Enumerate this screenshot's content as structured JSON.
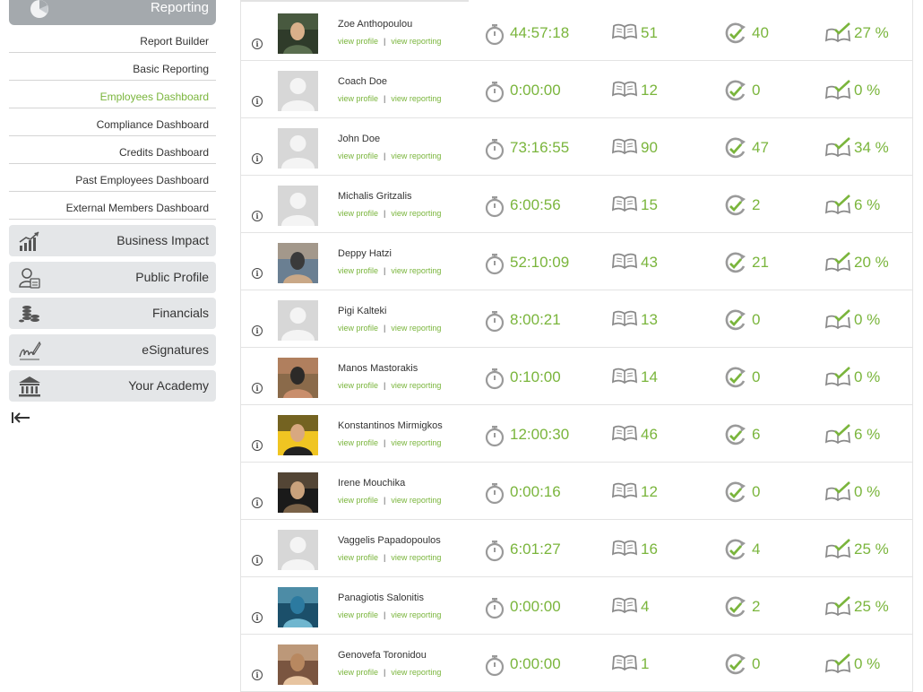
{
  "sidebar": {
    "reporting_label": "Reporting",
    "sub_items": [
      {
        "label": "Report Builder",
        "active": false
      },
      {
        "label": "Basic Reporting",
        "active": false
      },
      {
        "label": "Employees Dashboard",
        "active": true
      },
      {
        "label": "Compliance Dashboard",
        "active": false
      },
      {
        "label": "Credits Dashboard",
        "active": false
      },
      {
        "label": "Past Employees Dashboard",
        "active": false
      },
      {
        "label": "External Members Dashboard",
        "active": false
      }
    ],
    "menu": [
      {
        "label": "Business Impact",
        "icon": "chart-icon"
      },
      {
        "label": "Public Profile",
        "icon": "profile-icon"
      },
      {
        "label": "Financials",
        "icon": "coins-icon"
      },
      {
        "label": "eSignatures",
        "icon": "signature-icon"
      },
      {
        "label": "Your Academy",
        "icon": "academy-icon"
      }
    ]
  },
  "links": {
    "profile": "view profile",
    "reporting": "view reporting",
    "separator": "|"
  },
  "accent_color": "#7ab53c",
  "employees": [
    {
      "name": "Zoe Anthopoulou",
      "time": "44:57:18",
      "courses": "51",
      "completed": "40",
      "percent": "27 %",
      "photo": "photo"
    },
    {
      "name": "Coach Doe",
      "time": "0:00:00",
      "courses": "12",
      "completed": "0",
      "percent": "0 %",
      "photo": "placeholder"
    },
    {
      "name": "John Doe",
      "time": "73:16:55",
      "courses": "90",
      "completed": "47",
      "percent": "34 %",
      "photo": "placeholder"
    },
    {
      "name": "Michalis Gritzalis",
      "time": "6:00:56",
      "courses": "15",
      "completed": "2",
      "percent": "6 %",
      "photo": "placeholder"
    },
    {
      "name": "Deppy Hatzi",
      "time": "52:10:09",
      "courses": "43",
      "completed": "21",
      "percent": "20 %",
      "photo": "photo"
    },
    {
      "name": "Pigi Kalteki",
      "time": "8:00:21",
      "courses": "13",
      "completed": "0",
      "percent": "0 %",
      "photo": "placeholder"
    },
    {
      "name": "Manos Mastorakis",
      "time": "0:10:00",
      "courses": "14",
      "completed": "0",
      "percent": "0 %",
      "photo": "photo"
    },
    {
      "name": "Konstantinos Mirmigkos",
      "time": "12:00:30",
      "courses": "46",
      "completed": "6",
      "percent": "6 %",
      "photo": "photo"
    },
    {
      "name": "Irene Mouchika",
      "time": "0:00:16",
      "courses": "12",
      "completed": "0",
      "percent": "0 %",
      "photo": "photo"
    },
    {
      "name": "Vaggelis Papadopoulos",
      "time": "6:01:27",
      "courses": "16",
      "completed": "4",
      "percent": "25 %",
      "photo": "placeholder"
    },
    {
      "name": "Panagiotis Salonitis",
      "time": "0:00:00",
      "courses": "4",
      "completed": "2",
      "percent": "25 %",
      "photo": "photo"
    },
    {
      "name": "Genovefa Toronidou",
      "time": "0:00:00",
      "courses": "1",
      "completed": "0",
      "percent": "0 %",
      "photo": "photo"
    }
  ]
}
